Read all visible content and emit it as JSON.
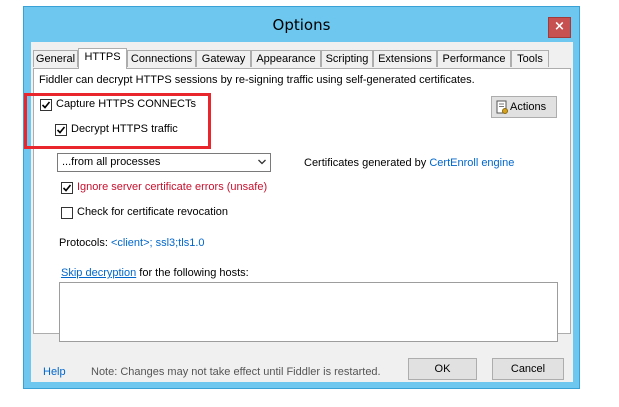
{
  "window": {
    "title": "Options",
    "close_glyph": "×"
  },
  "tabs": [
    {
      "label": "General"
    },
    {
      "label": "HTTPS"
    },
    {
      "label": "Connections"
    },
    {
      "label": "Gateway"
    },
    {
      "label": "Appearance"
    },
    {
      "label": "Scripting"
    },
    {
      "label": "Extensions"
    },
    {
      "label": "Performance"
    },
    {
      "label": "Tools"
    }
  ],
  "active_tab": "HTTPS",
  "https": {
    "description": "Fiddler can decrypt HTTPS sessions by re-signing traffic using self-generated certificates.",
    "capture_connects": {
      "label": "Capture HTTPS CONNECTs",
      "checked": true
    },
    "decrypt_traffic": {
      "label": "Decrypt HTTPS traffic",
      "checked": true
    },
    "actions_button": "Actions",
    "process_filter": {
      "selected": "...from all processes"
    },
    "certs_generated_prefix": "Certificates generated by ",
    "certs_generated_link": "CertEnroll engine",
    "ignore_errors": {
      "label": "Ignore server certificate errors (unsafe)",
      "checked": true
    },
    "check_revocation": {
      "label": "Check for certificate revocation",
      "checked": false
    },
    "protocols_label": "Protocols: ",
    "protocols_value": "<client>; ssl3;tls1.0",
    "skip_link": "Skip decryption",
    "skip_suffix": " for the following hosts:",
    "skip_hosts_value": ""
  },
  "footer": {
    "help": "Help",
    "note": "Note: Changes may not take effect until Fiddler is restarted.",
    "ok": "OK",
    "cancel": "Cancel"
  },
  "colors": {
    "highlight_box": "#e8262b",
    "link": "#0066cc",
    "warning_text": "#c8102e",
    "window_frame": "#6ec7ee"
  }
}
